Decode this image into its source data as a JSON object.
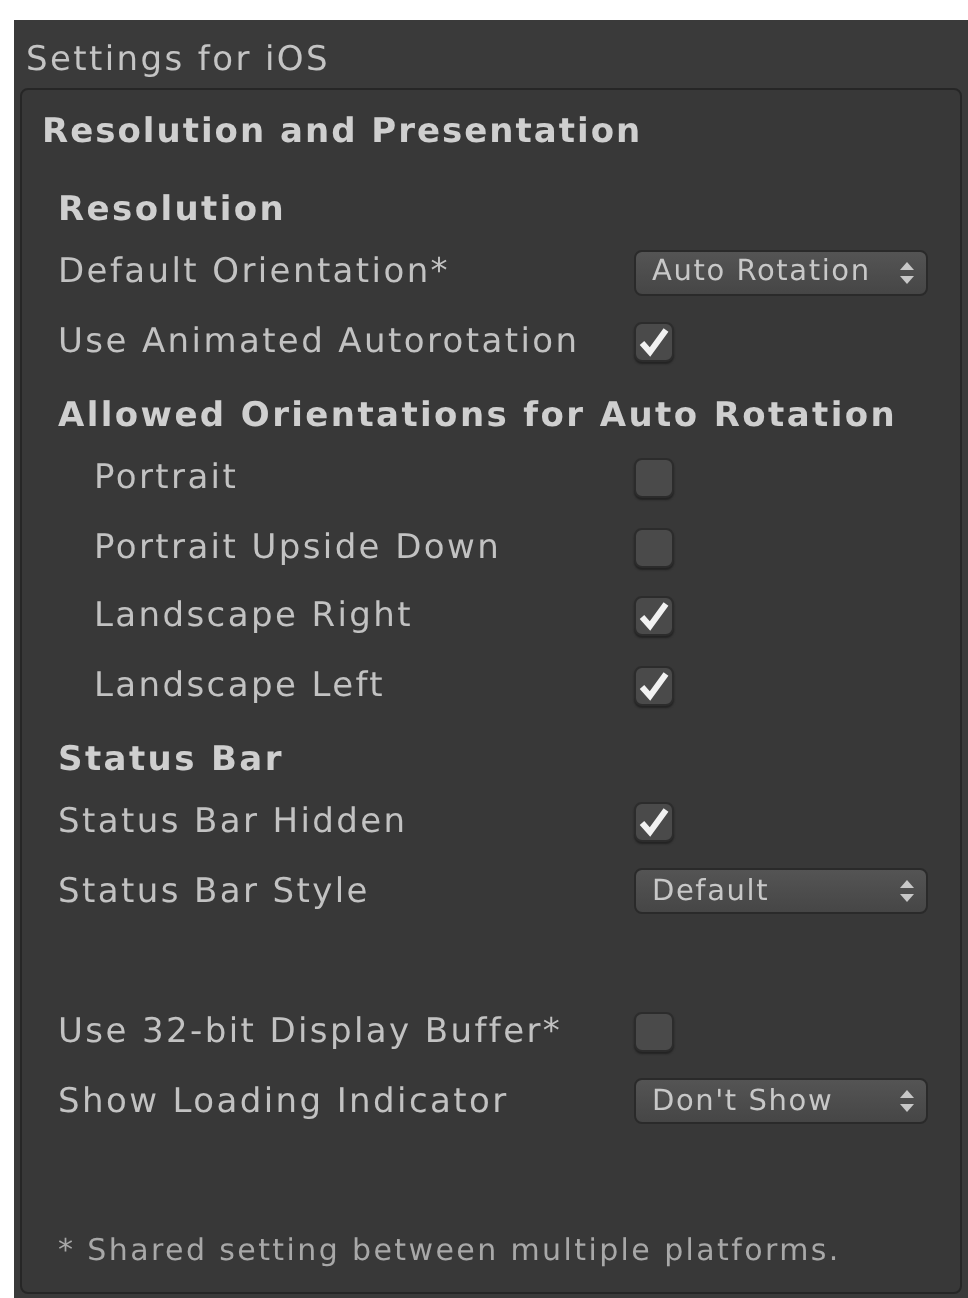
{
  "window": {
    "title": "Settings for iOS"
  },
  "panel": {
    "title": "Resolution and Presentation",
    "sections": [
      {
        "heading": "Resolution",
        "indented": false,
        "rows": [
          {
            "kind": "dropdown",
            "label": "Default Orientation*",
            "value": "Auto Rotation"
          },
          {
            "kind": "checkbox",
            "label": "Use Animated Autorotation",
            "checked": true
          }
        ]
      },
      {
        "heading": "Allowed Orientations for Auto Rotation",
        "indented": true,
        "rows": [
          {
            "kind": "checkbox",
            "label": "Portrait",
            "checked": false
          },
          {
            "kind": "checkbox",
            "label": "Portrait Upside Down",
            "checked": false
          },
          {
            "kind": "checkbox",
            "label": "Landscape Right",
            "checked": true
          },
          {
            "kind": "checkbox",
            "label": "Landscape Left",
            "checked": true
          }
        ]
      },
      {
        "heading": "Status Bar",
        "indented": false,
        "rows": [
          {
            "kind": "checkbox",
            "label": "Status Bar Hidden",
            "checked": true
          },
          {
            "kind": "dropdown",
            "label": "Status Bar Style",
            "value": "Default"
          }
        ]
      },
      {
        "indented": false,
        "rows": [
          {
            "kind": "checkbox",
            "label": "Use 32-bit Display Buffer*",
            "checked": false
          },
          {
            "kind": "dropdown",
            "label": "Show Loading Indicator",
            "value": "Don't Show"
          }
        ]
      }
    ],
    "footnote": "* Shared setting between multiple platforms."
  }
}
